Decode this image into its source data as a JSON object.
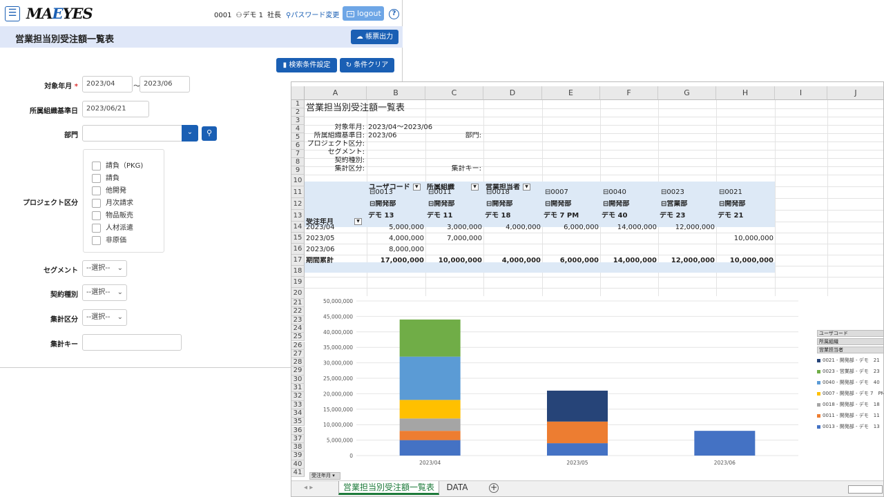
{
  "header": {
    "menu_icon": "☰",
    "logo_main": "MA",
    "logo_eye": "E",
    "logo_tail": "YES",
    "user_code": "0001",
    "user_name": "デモ 1",
    "user_role": "社長",
    "password_link": "パスワード変更",
    "logout_label": "logout",
    "help_label": "?"
  },
  "title": {
    "text": "営業担当別受注額一覧表",
    "report_button": "帳票出力"
  },
  "form": {
    "search_settings_button": "検索条件設定",
    "clear_button": "条件クリア",
    "period_label": "対象年月",
    "required_mark": "*",
    "period_from": "2023/04",
    "period_sep": "〜",
    "period_to": "2023/06",
    "org_date_label": "所属組織基準日",
    "org_date": "2023/06/21",
    "dept_label": "部門",
    "project_label": "プロジェクト区分",
    "project_options": [
      "請負（PKG)",
      "請負",
      "他開発",
      "月次請求",
      "物品販売",
      "人材派遣",
      "非原価"
    ],
    "segment_label": "セグメント",
    "segment_value": "--選択--",
    "contract_label": "契約種別",
    "contract_value": "--選択--",
    "agg_label": "集計区分",
    "agg_value": "--選択--",
    "agg_key_label": "集計キー"
  },
  "excel": {
    "columns": [
      "A",
      "B",
      "C",
      "D",
      "E",
      "F",
      "G",
      "H",
      "I",
      "J"
    ],
    "rows": [
      "1",
      "2",
      "3",
      "4",
      "5",
      "6",
      "7",
      "8",
      "9",
      "10",
      "11",
      "12",
      "13",
      "14",
      "15",
      "16",
      "17",
      "18",
      "19",
      "20",
      "21",
      "22",
      "23",
      "24",
      "25",
      "26",
      "27",
      "28",
      "29",
      "30",
      "31",
      "32",
      "33",
      "34",
      "35",
      "36",
      "37",
      "38",
      "39",
      "40",
      "41"
    ],
    "sheet_title": "営業担当別受注額一覧表",
    "info": {
      "period_label": "対象年月:",
      "period_value": "2023/04〜2023/06",
      "org_label": "所属組織基準日:",
      "org_value": "2023/06",
      "dept_label": "部門:",
      "project_label": "プロジェクト区分:",
      "segment_label": "セグメント:",
      "contract_label": "契約種別:",
      "agg_label": "集計区分:",
      "aggkey_label": "集計キー:"
    },
    "pivot": {
      "h_user": "ユーザコード",
      "h_org": "所属組織",
      "h_sales": "営業担当者",
      "h_month": "受注年月",
      "codes": [
        "⊟0013",
        "⊟0011",
        "⊟0018",
        "⊟0007",
        "⊟0040",
        "⊟0023",
        "⊟0021"
      ],
      "depts": [
        "⊟開発部",
        "⊟開発部",
        "⊟開発部",
        "⊟開発部",
        "⊟開発部",
        "⊟営業部",
        "⊟開発部"
      ],
      "names": [
        "デモ 13",
        "デモ 11",
        "デモ 18",
        "デモ 7 PM",
        "デモ 40",
        "デモ 23",
        "デモ 21"
      ],
      "data_rows": [
        {
          "month": "2023/04",
          "cells": [
            "5,000,000",
            "3,000,000",
            "4,000,000",
            "6,000,000",
            "14,000,000",
            "12,000,000",
            ""
          ]
        },
        {
          "month": "2023/05",
          "cells": [
            "4,000,000",
            "7,000,000",
            "",
            "",
            "",
            "",
            "10,000,000"
          ]
        },
        {
          "month": "2023/06",
          "cells": [
            "8,000,000",
            "",
            "",
            "",
            "",
            "",
            ""
          ]
        }
      ],
      "total_label": "期間累計",
      "totals": [
        "17,000,000",
        "10,000,000",
        "4,000,000",
        "6,000,000",
        "14,000,000",
        "12,000,000",
        "10,000,000"
      ]
    },
    "tabs": [
      "営業担当別受注額一覧表",
      "DATA"
    ],
    "add_tab": "+",
    "x_field": "受注年月"
  },
  "chart_data": {
    "type": "bar",
    "stacked": true,
    "categories": [
      "2023/04",
      "2023/05",
      "2023/06"
    ],
    "ylim": [
      0,
      50000000
    ],
    "y_ticks": [
      "0",
      "5,000,000",
      "10,000,000",
      "15,000,000",
      "20,000,000",
      "25,000,000",
      "30,000,000",
      "35,000,000",
      "40,000,000",
      "45,000,000",
      "50,000,000"
    ],
    "legend_position": "right",
    "legend_filters": [
      "ユーザコード",
      "所属組織",
      "営業担当者"
    ],
    "series": [
      {
        "name": "0013 - 開発部 - デモ　13",
        "color": "#4472c4",
        "values": [
          5000000,
          4000000,
          8000000
        ]
      },
      {
        "name": "0011 - 開発部 - デモ　11",
        "color": "#ed7d31",
        "values": [
          3000000,
          7000000,
          0
        ]
      },
      {
        "name": "0018 - 開発部 - デモ　18",
        "color": "#a5a5a5",
        "values": [
          4000000,
          0,
          0
        ]
      },
      {
        "name": "0007 - 開発部 - デモ 7　PM",
        "color": "#ffc000",
        "values": [
          6000000,
          0,
          0
        ]
      },
      {
        "name": "0040 - 開発部 - デモ　40",
        "color": "#5b9bd5",
        "values": [
          14000000,
          0,
          0
        ]
      },
      {
        "name": "0023 - 営業部 - デモ　23",
        "color": "#70ad47",
        "values": [
          12000000,
          0,
          0
        ]
      },
      {
        "name": "0021 - 開発部 - デモ　21",
        "color": "#264478",
        "values": [
          0,
          10000000,
          0
        ]
      }
    ]
  }
}
